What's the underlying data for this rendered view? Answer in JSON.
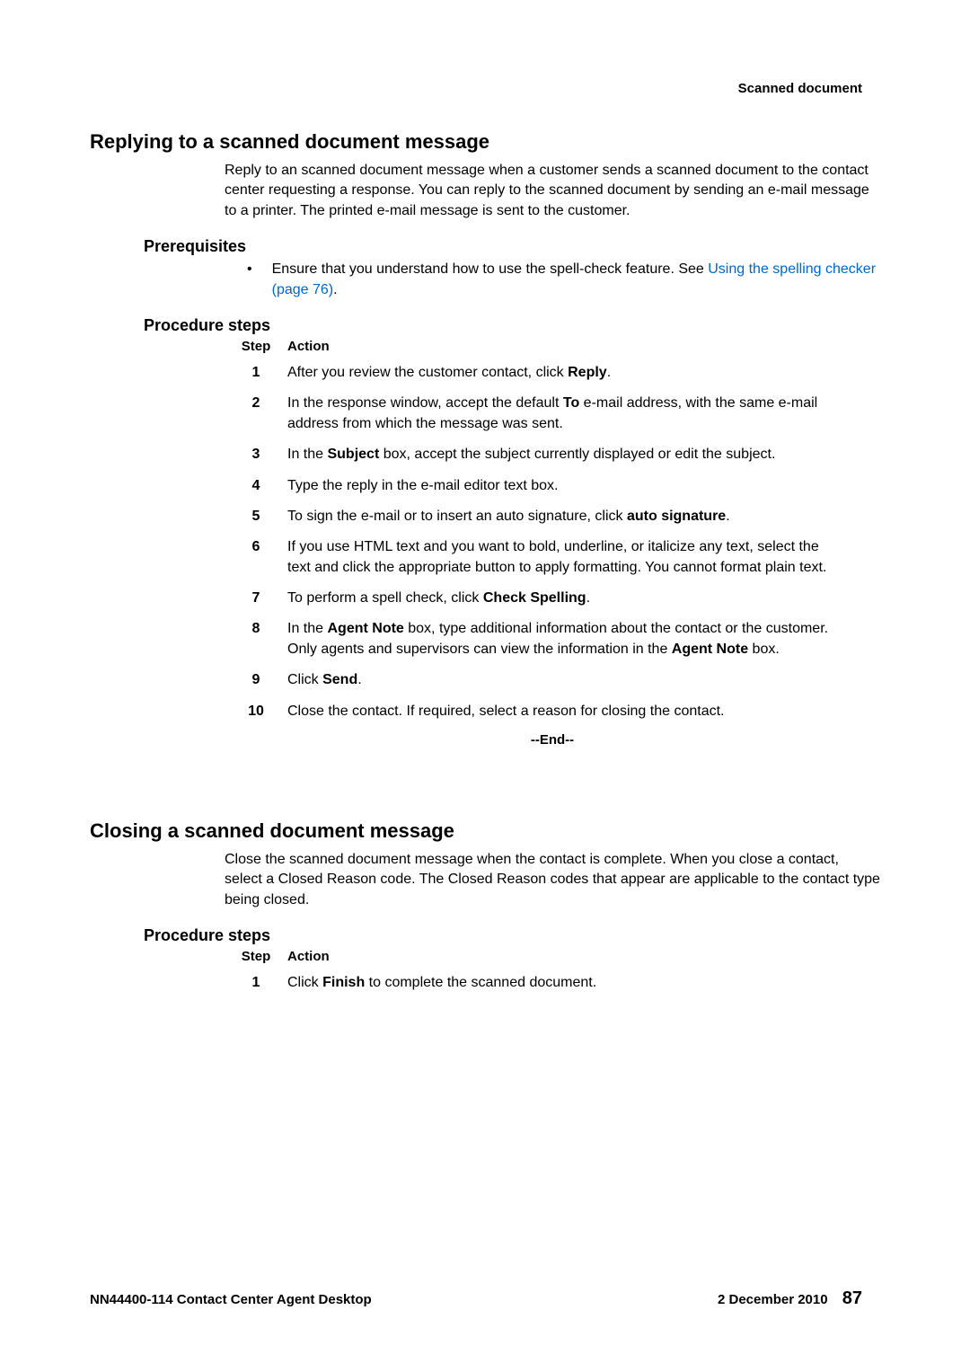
{
  "header": {
    "topRight": "Scanned document"
  },
  "section1": {
    "title": "Replying to a scanned document message",
    "intro": "Reply to an scanned document message when a customer sends a scanned document to the contact center requesting a response. You can reply to the scanned document by sending an e-mail message to a printer. The printed e-mail message is sent to the customer.",
    "prereqHeading": "Prerequisites",
    "prereqText": "Ensure that you understand how to use the spell-check feature. See ",
    "prereqLink": "Using the spelling checker (page 76)",
    "prereqEnd": ".",
    "procedureHeading": "Procedure steps",
    "tableHeader": {
      "step": "Step",
      "action": "Action"
    },
    "steps": [
      {
        "num": "1",
        "prefix": "After you review the customer contact, click ",
        "bold1": "Reply",
        "suffix": "."
      },
      {
        "num": "2",
        "prefix": "In the response window, accept the default ",
        "bold1": "To",
        "suffix": " e-mail address, with the same e-mail address from which the message was sent."
      },
      {
        "num": "3",
        "prefix": "In the ",
        "bold1": "Subject",
        "suffix": " box, accept the subject currently displayed or edit the subject."
      },
      {
        "num": "4",
        "prefix": "Type the reply in the e-mail editor text box.",
        "bold1": "",
        "suffix": ""
      },
      {
        "num": "5",
        "prefix": "To sign the e-mail or to insert an auto signature, click ",
        "bold1": "auto signature",
        "suffix": "."
      },
      {
        "num": "6",
        "prefix": "If you use HTML text and you want to bold, underline, or italicize any text, select the text and click the appropriate button to apply formatting. You cannot format plain text.",
        "bold1": "",
        "suffix": ""
      },
      {
        "num": "7",
        "prefix": "To perform a spell check, click ",
        "bold1": "Check Spelling",
        "suffix": "."
      },
      {
        "num": "8",
        "prefix": "In the ",
        "bold1": "Agent Note",
        "mid": " box, type additional information about the contact or the customer. Only agents and supervisors can view the information in the ",
        "bold2": "Agent Note",
        "suffix": " box."
      },
      {
        "num": "9",
        "prefix": "Click ",
        "bold1": "Send",
        "suffix": "."
      },
      {
        "num": "10",
        "prefix": "Close the contact. If required, select a reason for closing the contact.",
        "bold1": "",
        "suffix": ""
      }
    ],
    "endMarker": "--End--"
  },
  "section2": {
    "title": "Closing a scanned document message",
    "intro": "Close the scanned document message when the contact is complete. When you close a contact, select a Closed Reason code. The Closed Reason codes that appear are applicable to the contact type being closed.",
    "procedureHeading": "Procedure steps",
    "tableHeader": {
      "step": "Step",
      "action": "Action"
    },
    "steps": [
      {
        "num": "1",
        "prefix": "Click ",
        "bold1": "Finish",
        "suffix": " to complete the scanned document."
      }
    ]
  },
  "footer": {
    "left": "NN44400-114 Contact Center Agent Desktop",
    "date": "2 December 2010",
    "page": "87"
  }
}
